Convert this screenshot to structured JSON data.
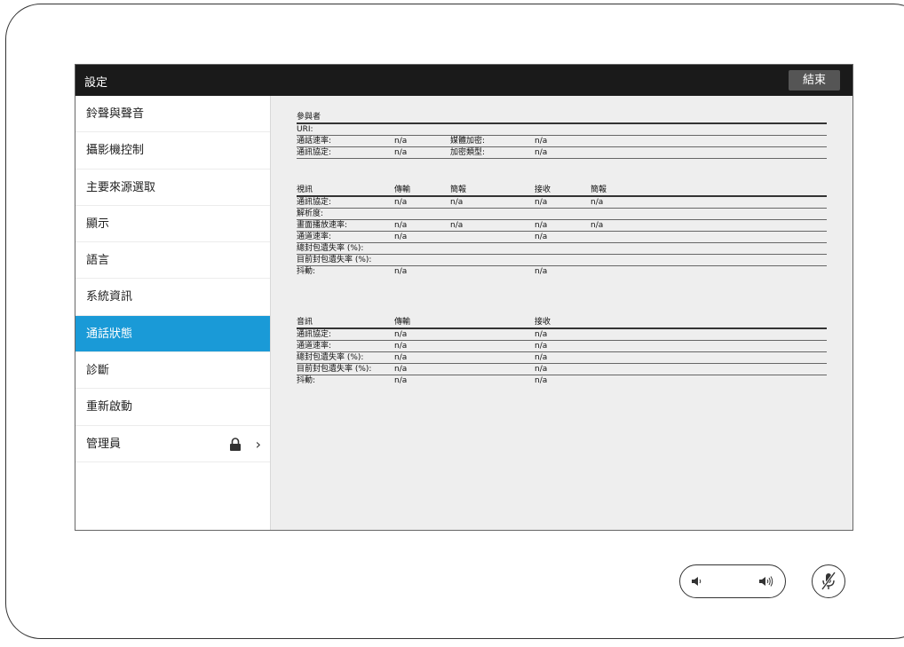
{
  "header": {
    "title": "設定",
    "end_label": "結束"
  },
  "sidebar": {
    "items": [
      {
        "label": "鈴聲與聲音"
      },
      {
        "label": "攝影機控制"
      },
      {
        "label": "主要來源選取"
      },
      {
        "label": "顯示"
      },
      {
        "label": "語言"
      },
      {
        "label": "系統資訊"
      },
      {
        "label": "通話狀態",
        "active": true
      },
      {
        "label": "診斷"
      },
      {
        "label": "重新啟動"
      },
      {
        "label": "管理員",
        "icons": [
          "lock-icon",
          "chevron-right-icon"
        ]
      }
    ]
  },
  "participants": {
    "header": "參與者",
    "uri_label": "URI:",
    "rows": [
      {
        "k1": "通話速率:",
        "v1": "n/a",
        "k2": "媒體加密:",
        "v2": "n/a"
      },
      {
        "k1": "通訊協定:",
        "v1": "n/a",
        "k2": "加密類型:",
        "v2": "n/a"
      }
    ]
  },
  "video": {
    "headers": {
      "c0": "視訊",
      "c1": "傳輸",
      "c2": "簡報",
      "c3": "接收",
      "c4": "簡報"
    },
    "rows": [
      {
        "c0": "通訊協定:",
        "c1": "n/a",
        "c2": "n/a",
        "c3": "n/a",
        "c4": "n/a"
      },
      {
        "c0": "解析度:",
        "c1": "",
        "c2": "",
        "c3": "",
        "c4": ""
      },
      {
        "c0": "畫面播放速率:",
        "c1": "n/a",
        "c2": "n/a",
        "c3": "n/a",
        "c4": "n/a"
      },
      {
        "c0": "通道速率:",
        "c1": "n/a",
        "c2": "",
        "c3": "n/a",
        "c4": ""
      },
      {
        "c0": "總封包遺失率 (%):",
        "c1": "",
        "c2": "",
        "c3": "",
        "c4": ""
      },
      {
        "c0": "目前封包遺失率 (%):",
        "c1": "",
        "c2": "",
        "c3": "",
        "c4": ""
      },
      {
        "c0": "抖動:",
        "c1": "n/a",
        "c2": "",
        "c3": "n/a",
        "c4": ""
      }
    ]
  },
  "audio": {
    "headers": {
      "c0": "音訊",
      "c1": "傳輸",
      "c3": "接收"
    },
    "rows": [
      {
        "c0": "通訊協定:",
        "c1": "n/a",
        "c3": "n/a"
      },
      {
        "c0": "通道速率:",
        "c1": "n/a",
        "c3": "n/a"
      },
      {
        "c0": "總封包遺失率 (%):",
        "c1": "n/a",
        "c3": "n/a"
      },
      {
        "c0": "目前封包遺失率 (%):",
        "c1": "n/a",
        "c3": "n/a"
      },
      {
        "c0": "抖動:",
        "c1": "n/a",
        "c3": "n/a"
      }
    ]
  },
  "controls": {
    "volume_icons": [
      "volume-down-icon",
      "volume-up-icon"
    ],
    "mute_icon": "mic-mute-icon"
  }
}
